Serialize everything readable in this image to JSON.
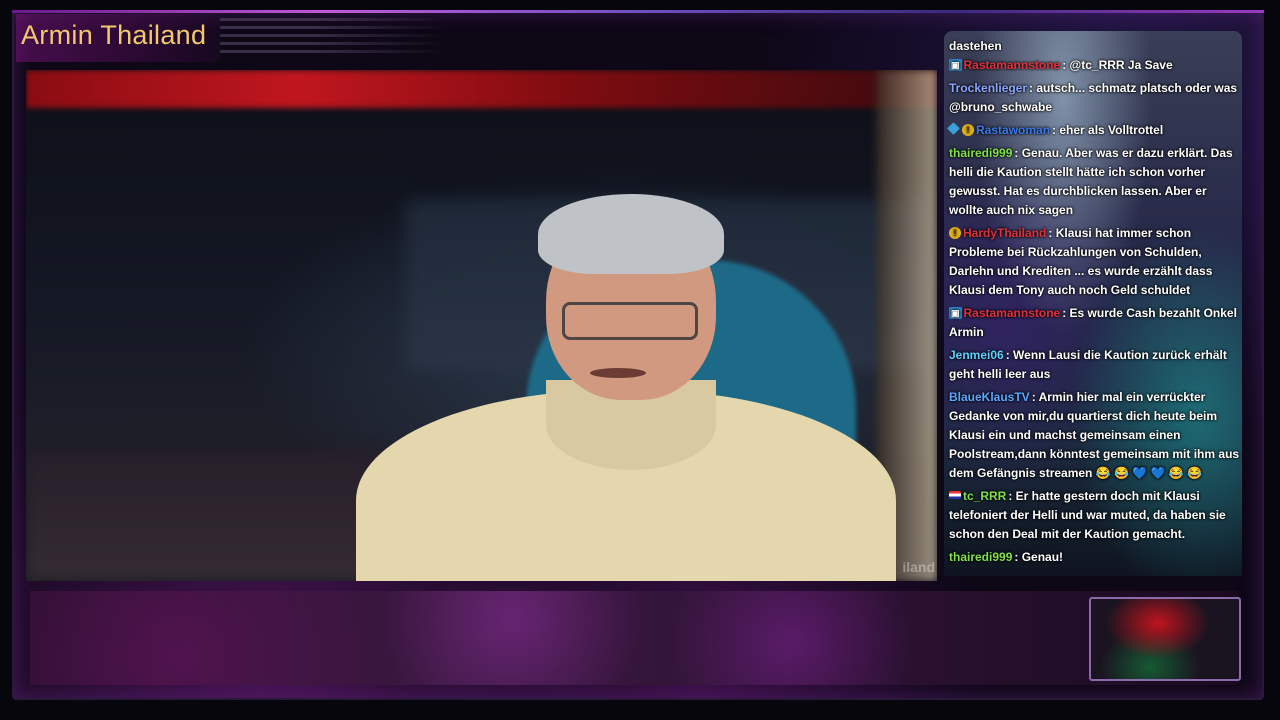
{
  "stream": {
    "title": "Armin Thailand",
    "webcam_watermark": "iland"
  },
  "chat": {
    "partial_top_line": "dastehen",
    "messages": [
      {
        "user": "Rastamannstone",
        "user_color": "#e0303c",
        "badges": [
          "sub-badge"
        ],
        "text": ": @tc_RRR Ja Save"
      },
      {
        "user": "Trockenlieger",
        "user_color": "#8aa6ff",
        "badges": [],
        "text": ": autsch... schmatz platsch oder was @bruno_schwabe"
      },
      {
        "user": "Rastawoman",
        "user_color": "#3a78e8",
        "badges": [
          "gem-badge",
          "coin-badge"
        ],
        "text": ": eher als Volltrottel"
      },
      {
        "user": "thairedi999",
        "user_color": "#7fe04a",
        "badges": [],
        "text": ": Genau. Aber was er dazu erklärt. Das helli die Kaution stellt hätte ich schon vorher gewusst. Hat es durchblicken lassen. Aber er wollte auch nix sagen"
      },
      {
        "user": "HardyThailand",
        "user_color": "#e0303c",
        "badges": [
          "coin-badge"
        ],
        "text": ": Klausi hat immer schon Probleme bei Rückzahlungen von Schulden, Darlehn und Krediten ... es wurde erzählt dass Klausi dem Tony auch noch Geld schuldet"
      },
      {
        "user": "Rastamannstone",
        "user_color": "#e0303c",
        "badges": [
          "sub-badge"
        ],
        "text": ": Es wurde Cash bezahlt Onkel Armin"
      },
      {
        "user": "Jenmei06",
        "user_color": "#5ad2ff",
        "badges": [],
        "text": ": Wenn Lausi die Kaution zurück erhält geht helli leer aus"
      },
      {
        "user": "BlaueKlausTV",
        "user_color": "#5aa8ff",
        "badges": [],
        "text": ": Armin hier mal ein verrückter Gedanke von mir,du quartierst dich heute beim Klausi ein und machst gemeinsam einen Poolstream,dann könntest gemeinsam mit ihm aus dem Gefängnis streamen 😂 😂 💙 💙 😂 😂"
      },
      {
        "user": "tc_RRR",
        "user_color": "#7fe04a",
        "badges": [
          "flag-badge"
        ],
        "text": ": Er hatte gestern doch mit Klausi telefoniert der Helli und war muted, da haben sie schon den Deal mit der Kaution gemacht."
      },
      {
        "user": "thairedi999",
        "user_color": "#7fe04a",
        "badges": [],
        "text": ": Genau!"
      }
    ]
  },
  "colors": {
    "title": "#f2c870",
    "accent": "#c05ad8"
  }
}
